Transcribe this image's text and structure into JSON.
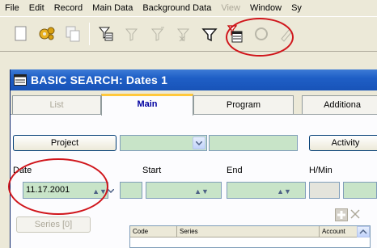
{
  "menu": {
    "items": [
      "File",
      "Edit",
      "Record",
      "Main Data",
      "Background Data",
      "View",
      "Window",
      "Sy"
    ],
    "disabled_index": 5
  },
  "toolbar": {
    "icons": [
      "new-document-icon",
      "gears-icon",
      "copy-icon",
      "filter-list-icon",
      "filter-disabled-icon",
      "filter-add-disabled-icon",
      "filter-remove-disabled-icon",
      "filter-icon",
      "filter-table-icon",
      "refresh-disabled-icon",
      "edit-disabled-icon"
    ]
  },
  "window": {
    "title": "BASIC SEARCH: Dates  1",
    "title_color": "#1f5fc6"
  },
  "tabs": [
    {
      "label": "List",
      "state": "disabled"
    },
    {
      "label": "Main",
      "state": "active"
    },
    {
      "label": "Program",
      "state": "normal"
    },
    {
      "label": "Additiona",
      "state": "normal"
    }
  ],
  "project": {
    "button_label": "Project",
    "activity_label": "Activity"
  },
  "dates": {
    "date_label": "Date",
    "start_label": "Start",
    "end_label": "End",
    "hmin_label": "H/Min",
    "date_value": "11.17.2001"
  },
  "series": {
    "button_label": "Series  [0]"
  },
  "grid": {
    "columns": [
      "Code",
      "Series",
      "Account"
    ]
  },
  "annotations": {
    "color": "#d0151b"
  }
}
